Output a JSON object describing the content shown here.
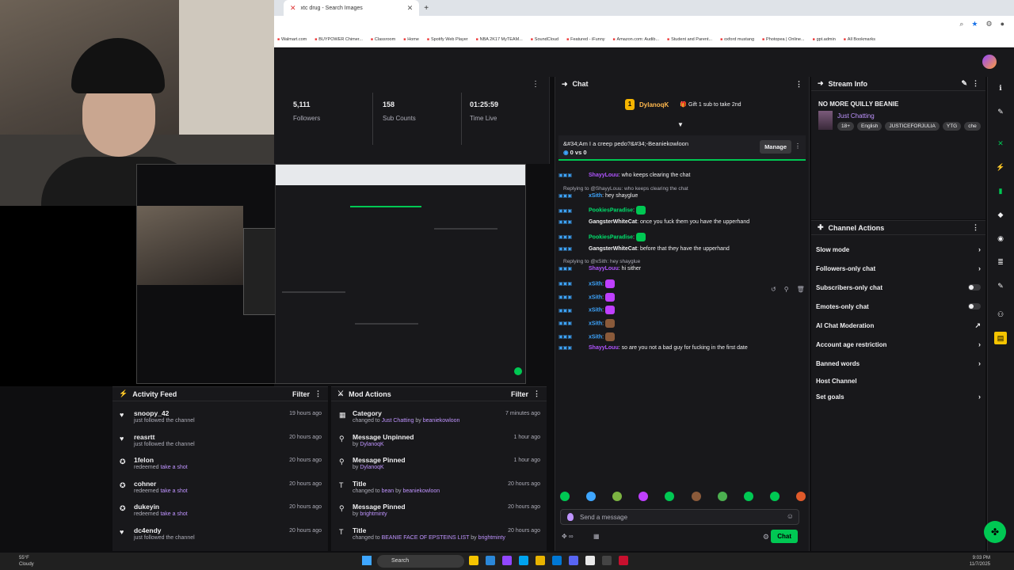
{
  "browser": {
    "tab_title": "xtc drug - Search Images",
    "bookmarks": [
      "Walmart.com",
      "BUYPOWER Chimer...",
      "Classroom",
      "Home",
      "Spotify Web Player",
      "NBA 2K17 MyTEAM...",
      "SoundCloud",
      "Featured - iFunny",
      "Amazon.com: Audib...",
      "Student and Parent...",
      "oxford mustang",
      "Photopea | Online...",
      "gpt.admin",
      "All Bookmarks"
    ]
  },
  "stats": [
    {
      "value": "5,111",
      "label": "Followers"
    },
    {
      "value": "158",
      "label": "Sub Counts"
    },
    {
      "value": "01:25:59",
      "label": "Time Live"
    }
  ],
  "activity_feed": {
    "title": "Activity Feed",
    "filter_label": "Filter",
    "items": [
      {
        "icon": "heart-icon",
        "glyph": "♥",
        "name": "snoopy_42",
        "desc": "just followed the channel",
        "reward": "",
        "time": "19 hours ago"
      },
      {
        "icon": "heart-icon",
        "glyph": "♥",
        "name": "reasrtt",
        "desc": "just followed the channel",
        "reward": "",
        "time": "20 hours ago"
      },
      {
        "icon": "channel-points-icon",
        "glyph": "✪",
        "name": "1felon",
        "desc": "redeemed ",
        "reward": "take a shot",
        "time": "20 hours ago"
      },
      {
        "icon": "channel-points-icon",
        "glyph": "✪",
        "name": "cohner",
        "desc": "redeemed ",
        "reward": "take a shot",
        "time": "20 hours ago"
      },
      {
        "icon": "channel-points-icon",
        "glyph": "✪",
        "name": "dukeyin",
        "desc": "redeemed ",
        "reward": "take a shot",
        "time": "20 hours ago"
      },
      {
        "icon": "heart-icon",
        "glyph": "♥",
        "name": "dc4endy",
        "desc": "just followed the channel",
        "reward": "",
        "time": "20 hours ago"
      }
    ]
  },
  "mod_actions": {
    "title": "Mod Actions",
    "filter_label": "Filter",
    "items": [
      {
        "icon": "category-icon",
        "glyph": "▦",
        "name": "Category",
        "pre": "changed to ",
        "hl": "Just Chatting",
        "mid": " by ",
        "by": "beaniekowloon",
        "time": "7 minutes ago"
      },
      {
        "icon": "unpin-icon",
        "glyph": "⚲",
        "name": "Message Unpinned",
        "pre": "by ",
        "hl": "",
        "mid": "",
        "by": "DylanoqK",
        "time": "1 hour ago"
      },
      {
        "icon": "pin-icon",
        "glyph": "⚲",
        "name": "Message Pinned",
        "pre": "by ",
        "hl": "",
        "mid": "",
        "by": "DylanoqK",
        "time": "1 hour ago"
      },
      {
        "icon": "title-icon",
        "glyph": "T",
        "name": "Title",
        "pre": "changed to ",
        "hl": "bean",
        "mid": " by ",
        "by": "beaniekowloon",
        "time": "20 hours ago"
      },
      {
        "icon": "pin-icon",
        "glyph": "⚲",
        "name": "Message Pinned",
        "pre": "by ",
        "hl": "",
        "mid": "",
        "by": "brightminty",
        "time": "20 hours ago"
      },
      {
        "icon": "title-icon",
        "glyph": "T",
        "name": "Title",
        "pre": "changed to ",
        "hl": "BEANIE FACE OF EPSTEINS LIST",
        "mid": " by ",
        "by": "brightminty",
        "time": "20 hours ago"
      }
    ]
  },
  "chat": {
    "title": "Chat",
    "leader": {
      "rank": "1",
      "name": "DylanoqK",
      "gift_text": "Gift 1 sub to take 2nd"
    },
    "poll": {
      "question": "&#34;Am I a creep pedo?&#34;-Beaniekowloon",
      "score": "0 vs 0",
      "manage_label": "Manage"
    },
    "messages": [
      {
        "kind": "msg",
        "user": "ShayyLouu",
        "color": "#b054ff",
        "text": ": who keeps clearing the chat",
        "emote": ""
      },
      {
        "kind": "reply",
        "text": "Replying to @ShayyLouu: who keeps clearing the chat"
      },
      {
        "kind": "msg",
        "user": "xSith",
        "color": "#3ea6ff",
        "text": ": hey shayglue",
        "emote": ""
      },
      {
        "kind": "msg",
        "user": "PookiesParadise",
        "color": "#00e06c",
        "text": ": ",
        "emote": "#00c853"
      },
      {
        "kind": "msg",
        "user": "GangsterWhiteCat",
        "color": "#efeff1",
        "text": ": once you fuck them you have the upperhand",
        "emote": ""
      },
      {
        "kind": "msg",
        "user": "PookiesParadise",
        "color": "#00e06c",
        "text": ": ",
        "emote": "#00c853"
      },
      {
        "kind": "msg",
        "user": "GangsterWhiteCat",
        "color": "#efeff1",
        "text": ": before that they have the upperhand",
        "emote": ""
      },
      {
        "kind": "reply",
        "text": "Replying to @xSith: hey shayglue"
      },
      {
        "kind": "msg",
        "user": "ShayyLouu",
        "color": "#b054ff",
        "text": ": hi sither",
        "emote": ""
      },
      {
        "kind": "msg",
        "user": "xSith",
        "color": "#3ea6ff",
        "text": ": ",
        "emote": "#bf3fff"
      },
      {
        "kind": "msg",
        "user": "xSith",
        "color": "#3ea6ff",
        "text": ": ",
        "emote": "#bf3fff"
      },
      {
        "kind": "msg",
        "user": "xSith",
        "color": "#3ea6ff",
        "text": ": ",
        "emote": "#bf3fff"
      },
      {
        "kind": "msg",
        "user": "xSith",
        "color": "#3ea6ff",
        "text": ": ",
        "emote": "#8a5a3a"
      },
      {
        "kind": "msg",
        "user": "xSith",
        "color": "#3ea6ff",
        "text": ": ",
        "emote": "#8a5a3a"
      },
      {
        "kind": "msg",
        "user": "ShayyLouu",
        "color": "#b054ff",
        "text": ": so are you not a bad guy for fucking in the first date",
        "emote": ""
      }
    ],
    "input_placeholder": "Send a message",
    "send_label": "Chat"
  },
  "stream_info": {
    "title": "Stream Info",
    "stream_title": "NO MORE QUILLY BEANIE",
    "category": "Just Chatting",
    "tags": [
      "18+",
      "English",
      "JUSTICEFORJULIA",
      "YTG",
      "che"
    ]
  },
  "channel_actions": {
    "title": "Channel Actions",
    "items": [
      {
        "label": "Slow mode",
        "control": "arrow"
      },
      {
        "label": "Followers-only chat",
        "control": "arrow"
      },
      {
        "label": "Subscribers-only chat",
        "control": "toggle"
      },
      {
        "label": "Emotes-only chat",
        "control": "toggle"
      },
      {
        "label": "AI Chat Moderation",
        "control": "external"
      },
      {
        "label": "Account age restriction",
        "control": "arrow"
      },
      {
        "label": "Banned words",
        "control": "arrow"
      },
      {
        "label": "Host Channel",
        "control": "none"
      },
      {
        "label": "Set goals",
        "control": "arrow"
      }
    ]
  },
  "taskbar": {
    "weather_temp": "55°F",
    "weather_desc": "Cloudy",
    "search_label": "Search",
    "time": "9:03 PM",
    "date": "11/7/2025"
  },
  "colors": {
    "accent": "#00c853",
    "purple": "#bf94ff",
    "bg": "#18181b"
  }
}
